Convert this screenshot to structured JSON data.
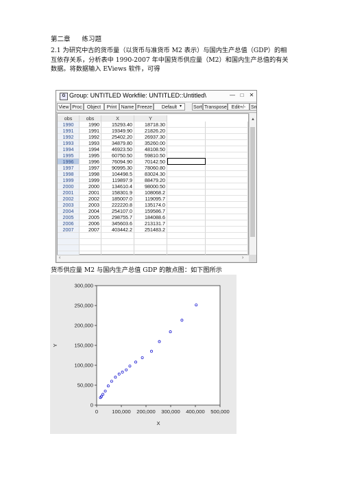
{
  "heading": {
    "chapter": "第二章",
    "title": "练习题"
  },
  "intro": "2.1 为研究中古的货币量（以货币与准货币 M2 表示）与国内生产总值（GDP）的相互依存关系，分析表中 1990-2007 年中国货币供应量（M2）和国内生产总值的有关数据。将数据输入 EViews 软件，可得",
  "window": {
    "title": "Group: UNTITLED   Workfile: UNTITLED::Untitled\\",
    "toolbar": [
      "View",
      "Proc",
      "Object",
      "Print",
      "Name",
      "Freeze",
      "Default",
      "Sort",
      "Transpose",
      "Edit+/-",
      "Smpl"
    ],
    "columns": [
      "obs",
      "obs",
      "X",
      "Y"
    ],
    "rows": [
      [
        "1990",
        "1990",
        "15293.40",
        "18718.30"
      ],
      [
        "1991",
        "1991",
        "19349.90",
        "21826.20"
      ],
      [
        "1992",
        "1992",
        "25402.20",
        "26937.30"
      ],
      [
        "1993",
        "1993",
        "34879.80",
        "35260.00"
      ],
      [
        "1994",
        "1994",
        "46923.50",
        "48108.50"
      ],
      [
        "1995",
        "1995",
        "60750.50",
        "59810.50"
      ],
      [
        "1996",
        "1996",
        "76094.90",
        "70142.50"
      ],
      [
        "1997",
        "1997",
        "90995.30",
        "78060.80"
      ],
      [
        "1998",
        "1998",
        "104498.5",
        "83024.30"
      ],
      [
        "1999",
        "1999",
        "119897.9",
        "88479.20"
      ],
      [
        "2000",
        "2000",
        "134610.4",
        "98000.50"
      ],
      [
        "2001",
        "2001",
        "158301.9",
        "108068.2"
      ],
      [
        "2002",
        "2002",
        "185007.0",
        "119095.7"
      ],
      [
        "2003",
        "2003",
        "222220.8",
        "135174.0"
      ],
      [
        "2004",
        "2004",
        "254107.0",
        "159586.7"
      ],
      [
        "2005",
        "2005",
        "298755.7",
        "184088.6"
      ],
      [
        "2006",
        "2006",
        "345603.6",
        "213131.7"
      ],
      [
        "2007",
        "2007",
        "403442.2",
        "251483.2"
      ]
    ]
  },
  "caption": "货币供应量 M2 与国内生产总值 GDP 的散点图：如下图所示",
  "chart_data": {
    "type": "scatter",
    "xlabel": "X",
    "ylabel": "Y",
    "xlim": [
      0,
      500000
    ],
    "ylim": [
      0,
      300000
    ],
    "xticks": [
      "0",
      "100,000",
      "200,000",
      "300,000",
      "400,000",
      "500,000"
    ],
    "yticks": [
      "0",
      "50,000",
      "100,000",
      "150,000",
      "200,000",
      "250,000",
      "300,000"
    ],
    "marker_color": "#0000cc",
    "x": [
      15293.4,
      19349.9,
      25402.2,
      34879.8,
      46923.5,
      60750.5,
      76094.9,
      90995.3,
      104498.5,
      119897.9,
      134610.4,
      158301.9,
      185007.0,
      222220.8,
      254107.0,
      298755.7,
      345603.6,
      403442.2
    ],
    "y": [
      18718.3,
      21826.2,
      26937.3,
      35260.0,
      48108.5,
      59810.5,
      70142.5,
      78060.8,
      83024.3,
      88479.2,
      98000.5,
      108068.2,
      119095.7,
      135174.0,
      159586.7,
      184088.6,
      213131.7,
      251483.2
    ]
  }
}
